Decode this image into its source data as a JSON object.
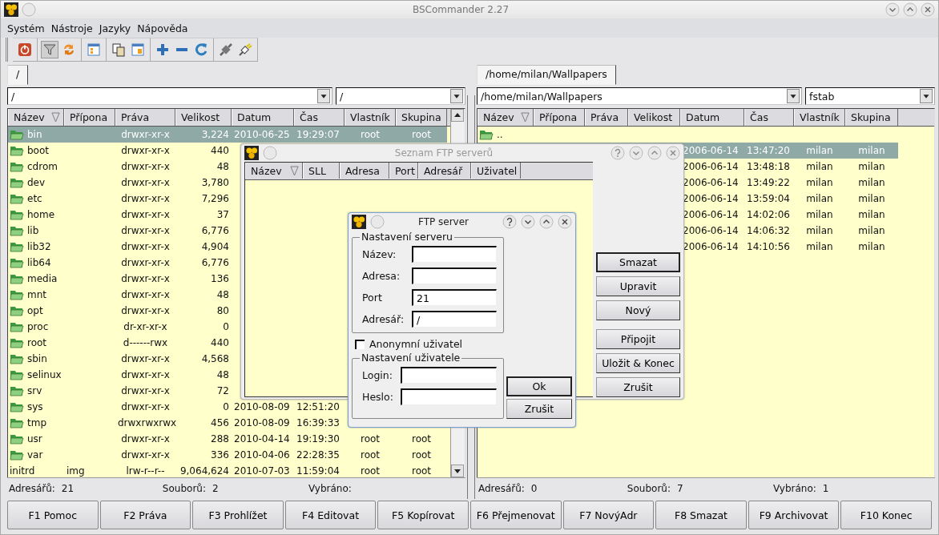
{
  "window": {
    "title": "BSCommander 2.27"
  },
  "menu": [
    "Systém",
    "Nástroje",
    "Jazyky",
    "Nápověda"
  ],
  "panels": [
    {
      "tab": {
        "label": "/",
        "selected": true
      },
      "path": "/",
      "filter": "/",
      "columns": [
        "Název",
        "Přípona",
        "Práva",
        "Velikost",
        "Datum",
        "Čas",
        "Vlastník",
        "Skupina"
      ],
      "rows": [
        {
          "kind": "folder",
          "selected": true,
          "name": "bin",
          "perms": "drwxr-xr-x",
          "size": "3,224",
          "date": "2010-06-25",
          "time": "19:29:07",
          "owner": "root",
          "group": "root"
        },
        {
          "kind": "folder",
          "selected": false,
          "name": "boot",
          "perms": "drwxr-xr-x",
          "size": "440"
        },
        {
          "kind": "folder",
          "selected": false,
          "name": "cdrom",
          "perms": "drwxr-xr-x",
          "size": "48"
        },
        {
          "kind": "folder",
          "selected": false,
          "name": "dev",
          "perms": "drwxr-xr-x",
          "size": "3,780"
        },
        {
          "kind": "folder",
          "selected": false,
          "name": "etc",
          "perms": "drwxr-xr-x",
          "size": "7,296"
        },
        {
          "kind": "folder",
          "selected": false,
          "name": "home",
          "perms": "drwxr-xr-x",
          "size": "37"
        },
        {
          "kind": "folder",
          "selected": false,
          "name": "lib",
          "perms": "drwxr-xr-x",
          "size": "6,776"
        },
        {
          "kind": "folder",
          "selected": false,
          "name": "lib32",
          "perms": "drwxr-xr-x",
          "size": "4,904"
        },
        {
          "kind": "folder",
          "selected": false,
          "name": "lib64",
          "perms": "drwxr-xr-x",
          "size": "6,776"
        },
        {
          "kind": "folder",
          "selected": false,
          "name": "media",
          "perms": "drwxr-xr-x",
          "size": "136"
        },
        {
          "kind": "folder",
          "selected": false,
          "name": "mnt",
          "perms": "drwxr-xr-x",
          "size": "48"
        },
        {
          "kind": "folder",
          "selected": false,
          "name": "opt",
          "perms": "drwxr-xr-x",
          "size": "80"
        },
        {
          "kind": "folder",
          "selected": false,
          "name": "proc",
          "perms": "dr-xr-xr-x",
          "size": "0"
        },
        {
          "kind": "folder",
          "selected": false,
          "name": "root",
          "perms": "d------rwx",
          "size": "440"
        },
        {
          "kind": "folder",
          "selected": false,
          "name": "sbin",
          "perms": "drwxr-xr-x",
          "size": "4,568"
        },
        {
          "kind": "folder",
          "selected": false,
          "name": "selinux",
          "perms": "drwxr-xr-x",
          "size": "48"
        },
        {
          "kind": "folder",
          "selected": false,
          "name": "srv",
          "perms": "drwxr-xr-x",
          "size": "72"
        },
        {
          "kind": "folder",
          "selected": false,
          "name": "sys",
          "perms": "drwxr-xr-x",
          "size": "0",
          "date": "2010-08-09",
          "time": "12:51:20"
        },
        {
          "kind": "folder",
          "selected": false,
          "name": "tmp",
          "perms": "drwxrwxrwx",
          "size": "456",
          "date": "2010-08-09",
          "time": "16:39:33"
        },
        {
          "kind": "folder",
          "selected": false,
          "name": "usr",
          "perms": "drwxr-xr-x",
          "size": "288",
          "date": "2010-04-14",
          "time": "19:19:30",
          "owner": "root",
          "group": "root"
        },
        {
          "kind": "folder",
          "selected": false,
          "name": "var",
          "perms": "drwxr-xr-x",
          "size": "336",
          "date": "2010-04-06",
          "time": "22:28:35",
          "owner": "root",
          "group": "root"
        },
        {
          "kind": "file",
          "selected": false,
          "name": "initrd",
          "ext": "img",
          "perms": "lrw-r--r--",
          "size": "9,064,624",
          "date": "2010-07-03",
          "time": "11:59:04",
          "owner": "root",
          "group": "root"
        }
      ],
      "status": {
        "dirs_label": "Adresářů:",
        "dirs": "21",
        "files_label": "Souborů:",
        "files": "2",
        "selected_label": "Vybráno:"
      }
    },
    {
      "tab": {
        "label": "/home/milan/Wallpapers",
        "selected": true
      },
      "path": "/home/milan/Wallpapers",
      "filter": "fstab",
      "columns": [
        "Název",
        "Přípona",
        "Práva",
        "Velikost",
        "Datum",
        "Čas",
        "Vlastník",
        "Skupina"
      ],
      "rows": [
        {
          "kind": "folder",
          "selected": false,
          "name": ".."
        },
        {
          "kind": "file",
          "selected": true,
          "date": "2006-06-14",
          "time": "13:47:20",
          "owner": "milan",
          "group": "milan"
        },
        {
          "kind": "file",
          "selected": false,
          "date": "2006-06-14",
          "time": "13:48:18",
          "owner": "milan",
          "group": "milan"
        },
        {
          "kind": "file",
          "selected": false,
          "date": "2006-06-14",
          "time": "13:49:22",
          "owner": "milan",
          "group": "milan"
        },
        {
          "kind": "file",
          "selected": false,
          "date": "2006-06-14",
          "time": "13:59:04",
          "owner": "milan",
          "group": "milan"
        },
        {
          "kind": "file",
          "selected": false,
          "date": "2006-06-14",
          "time": "14:02:06",
          "owner": "milan",
          "group": "milan"
        },
        {
          "kind": "file",
          "selected": false,
          "date": "2006-06-14",
          "time": "14:06:32",
          "owner": "milan",
          "group": "milan"
        },
        {
          "kind": "file",
          "selected": false,
          "date": "2006-06-14",
          "time": "14:10:56",
          "owner": "milan",
          "group": "milan"
        }
      ],
      "status": {
        "dirs_label": "Adresářů:",
        "dirs": "0",
        "files_label": "Souborů:",
        "files": "7",
        "selected_label": "Vybráno:",
        "selected": "1"
      }
    }
  ],
  "function_keys": [
    "F1 Pomoc",
    "F2 Práva",
    "F3 Prohlížet",
    "F4 Editovat",
    "F5 Kopírovat",
    "F6 Přejmenovat",
    "F7 NovýAdr",
    "F8 Smazat",
    "F9 Archivovat",
    "F10 Konec"
  ],
  "server_list_dialog": {
    "title": "Seznam FTP serverů",
    "columns": [
      "Název",
      "SLL",
      "Adresa",
      "Port",
      "Adresář",
      "Uživatel"
    ],
    "buttons": [
      "Smazat",
      "Upravit",
      "Nový",
      "Připojit",
      "Uložit & Konec",
      "Zrušit"
    ]
  },
  "server_dialog": {
    "title": "FTP server",
    "server_group": "Nastavení serveru",
    "fields": [
      {
        "label": "Název:"
      },
      {
        "label": "Adresa:"
      },
      {
        "label": "Port",
        "value": "21"
      },
      {
        "label": "Adresář:",
        "value": "/"
      }
    ],
    "anonymous": {
      "label": "Anonymní uživatel",
      "checked": false
    },
    "user_group": "Nastavení uživatele",
    "user_fields": [
      {
        "label": "Login:"
      },
      {
        "label": "Heslo:"
      }
    ],
    "buttons": [
      "Ok",
      "Zrušit"
    ]
  }
}
